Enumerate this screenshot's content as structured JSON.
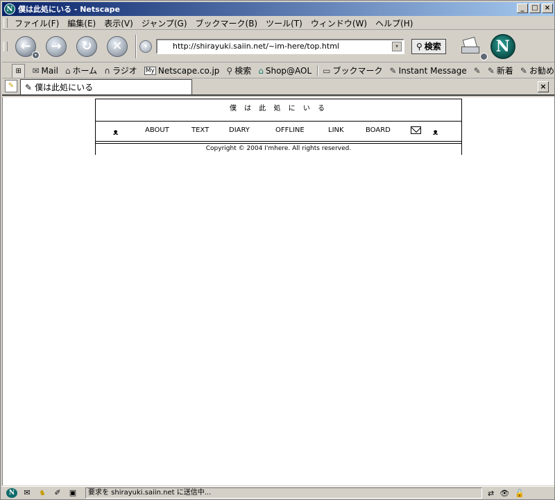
{
  "window": {
    "title": "僕は此処にいる - Netscape",
    "app_icon": "N",
    "buttons": {
      "minimize": "_",
      "maximize": "□",
      "close": "×"
    }
  },
  "menu": [
    "ファイル(F)",
    "編集(E)",
    "表示(V)",
    "ジャンプ(G)",
    "ブックマーク(B)",
    "ツール(T)",
    "ウィンドウ(W)",
    "ヘルプ(H)"
  ],
  "navbar": {
    "url": "http://shirayuki.saiin.net/~im-here/top.html",
    "search_label": "検索"
  },
  "personal_toolbar": {
    "items": [
      {
        "icon": "mail-icon",
        "glyph": "✉",
        "label": "Mail"
      },
      {
        "icon": "home-icon",
        "glyph": "⌂",
        "label": "ホーム"
      },
      {
        "icon": "radio-icon",
        "glyph": "∩",
        "label": "ラジオ"
      },
      {
        "icon": "my-netscape-icon",
        "glyph": "My",
        "label": "Netscape.co.jp"
      },
      {
        "icon": "search-icon",
        "glyph": "⚲",
        "label": "検索"
      },
      {
        "icon": "shop-icon",
        "glyph": "⌂",
        "label": "Shop@AOL"
      }
    ],
    "items2": [
      {
        "icon": "bookmark-folder-icon",
        "glyph": "▭",
        "label": "ブックマーク"
      },
      {
        "icon": "link-icon",
        "glyph": "✎",
        "label": "Instant Message"
      },
      {
        "icon": "link-icon",
        "glyph": "✎",
        "label": ""
      },
      {
        "icon": "link-icon",
        "glyph": "✎",
        "label": "新着"
      },
      {
        "icon": "link-icon",
        "glyph": "✎",
        "label": "お勧め"
      }
    ]
  },
  "tab": {
    "title": "僕は此処にいる"
  },
  "site": {
    "title": "僕 は 此 処 に い る",
    "nav": [
      "ABOUT",
      "TEXT",
      "DIARY",
      "OFFLINE",
      "LINK",
      "BOARD"
    ],
    "copyright": "Copyright © 2004 I'mhere. All rights reserved."
  },
  "status": {
    "text": "要求を shirayuki.saiin.net に送信中..."
  }
}
